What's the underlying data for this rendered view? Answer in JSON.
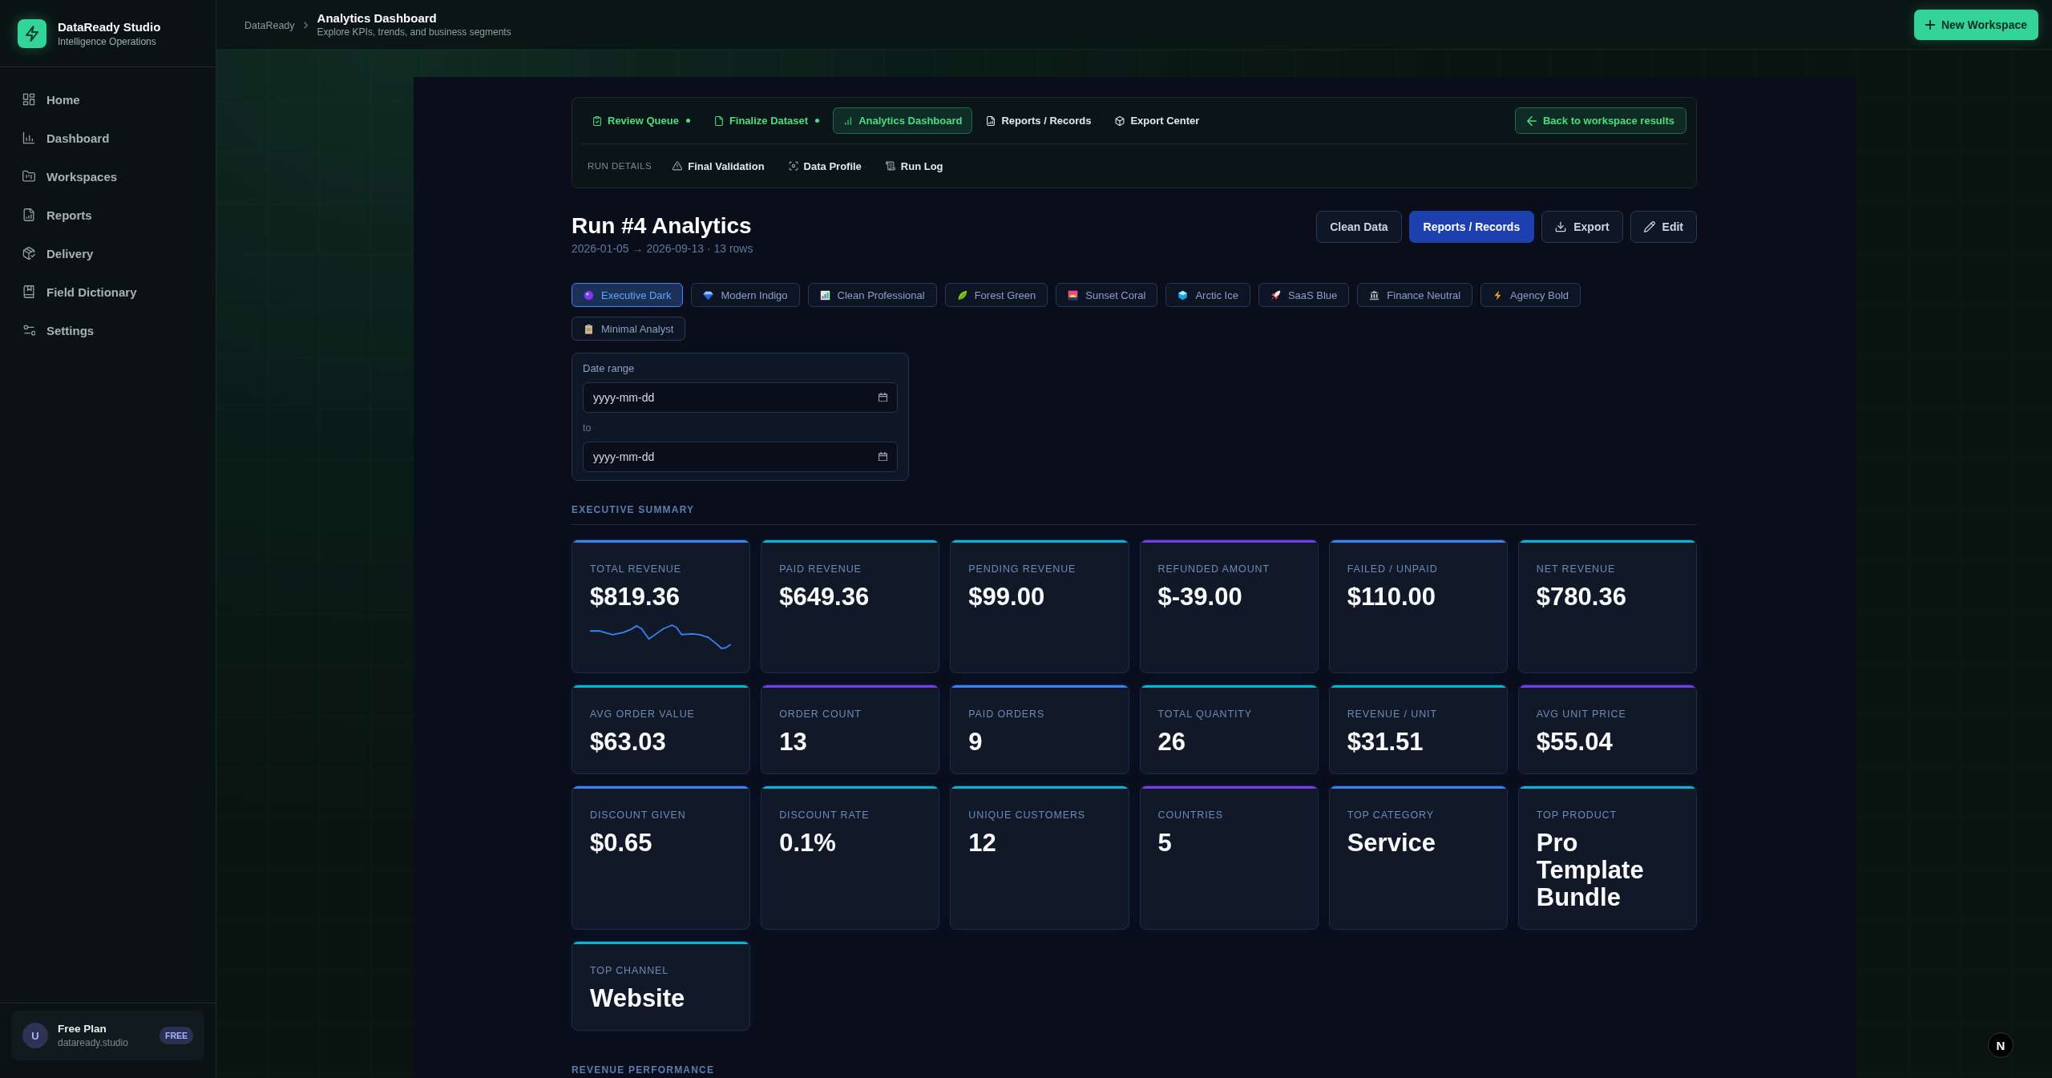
{
  "sidebar": {
    "brand": {
      "name": "DataReady Studio",
      "tagline": "Intelligence Operations"
    },
    "nav": [
      "Home",
      "Dashboard",
      "Workspaces",
      "Reports",
      "Delivery",
      "Field Dictionary",
      "Settings"
    ],
    "plan": {
      "avatar": "U",
      "title": "Free Plan",
      "domain": "dataready.studio",
      "badge": "FREE"
    }
  },
  "header": {
    "breadcrumb": "DataReady",
    "title": "Analytics Dashboard",
    "subtitle": "Explore KPIs, trends, and business segments",
    "button": "New Workspace"
  },
  "workflow": {
    "tabs": [
      {
        "label": "Review Queue",
        "selected": false,
        "done": true
      },
      {
        "label": "Finalize Dataset",
        "selected": false,
        "done": true
      },
      {
        "label": "Analytics Dashboard",
        "selected": true,
        "done": false
      },
      {
        "label": "Reports / Records",
        "selected": false,
        "done": false
      },
      {
        "label": "Export Center",
        "selected": false,
        "done": false
      }
    ],
    "back_button": "Back to workspace results",
    "run_details": {
      "label": "RUN DETAILS",
      "links": [
        "Final Validation",
        "Data Profile",
        "Run Log"
      ]
    }
  },
  "run": {
    "title": "Run #4 Analytics",
    "meta": "2026-01-05 → 2026-09-13 · 13 rows",
    "actions": [
      {
        "label": "Clean Data",
        "kind": "secondary"
      },
      {
        "label": "Reports / Records",
        "kind": "primary"
      },
      {
        "label": "Export",
        "kind": "secondary"
      },
      {
        "label": "Edit",
        "kind": "secondary"
      }
    ]
  },
  "themes": [
    {
      "label": "Executive Dark",
      "selected": true
    },
    {
      "label": "Modern Indigo",
      "selected": false
    },
    {
      "label": "Clean Professional",
      "selected": false
    },
    {
      "label": "Forest Green",
      "selected": false
    },
    {
      "label": "Sunset Coral",
      "selected": false
    },
    {
      "label": "Arctic Ice",
      "selected": false
    },
    {
      "label": "SaaS Blue",
      "selected": false
    },
    {
      "label": "Finance Neutral",
      "selected": false
    },
    {
      "label": "Agency Bold",
      "selected": false
    },
    {
      "label": "Minimal Analyst",
      "selected": false
    }
  ],
  "date_range": {
    "label": "Date range",
    "fields": [
      {
        "placeholder": "yyyy-mm-dd"
      },
      {
        "placeholder": "yyyy-mm-dd"
      }
    ],
    "separator": "to"
  },
  "executive_summary": {
    "title": "EXECUTIVE SUMMARY",
    "kpis": [
      {
        "label": "TOTAL REVENUE",
        "value": "$819.36",
        "color": "#3b82f6",
        "sparkline": true
      },
      {
        "label": "PAID REVENUE",
        "value": "$649.36",
        "color": "#06b6d4",
        "sparkline": false
      },
      {
        "label": "PENDING REVENUE",
        "value": "$99.00",
        "color": "#06b6d4",
        "sparkline": false
      },
      {
        "label": "REFUNDED AMOUNT",
        "value": "$-39.00",
        "color": "#7c3aed",
        "sparkline": false
      },
      {
        "label": "FAILED / UNPAID",
        "value": "$110.00",
        "color": "#3b82f6",
        "sparkline": false
      },
      {
        "label": "NET REVENUE",
        "value": "$780.36",
        "color": "#06b6d4",
        "sparkline": false
      },
      {
        "label": "AVG ORDER VALUE",
        "value": "$63.03",
        "color": "#06b6d4",
        "sparkline": false
      },
      {
        "label": "ORDER COUNT",
        "value": "13",
        "color": "#7c3aed",
        "sparkline": false
      },
      {
        "label": "PAID ORDERS",
        "value": "9",
        "color": "#3b82f6",
        "sparkline": false
      },
      {
        "label": "TOTAL QUANTITY",
        "value": "26",
        "color": "#06b6d4",
        "sparkline": false
      },
      {
        "label": "REVENUE / UNIT",
        "value": "$31.51",
        "color": "#06b6d4",
        "sparkline": false
      },
      {
        "label": "AVG UNIT PRICE",
        "value": "$55.04",
        "color": "#7c3aed",
        "sparkline": false
      },
      {
        "label": "DISCOUNT GIVEN",
        "value": "$0.65",
        "color": "#3b82f6",
        "sparkline": false
      },
      {
        "label": "DISCOUNT RATE",
        "value": "0.1%",
        "color": "#06b6d4",
        "sparkline": false
      },
      {
        "label": "UNIQUE CUSTOMERS",
        "value": "12",
        "color": "#06b6d4",
        "sparkline": false
      },
      {
        "label": "COUNTRIES",
        "value": "5",
        "color": "#7c3aed",
        "sparkline": false
      },
      {
        "label": "TOP CATEGORY",
        "value": "Service",
        "color": "#3b82f6",
        "sparkline": false
      },
      {
        "label": "TOP PRODUCT",
        "value": "Pro Template Bundle",
        "color": "#06b6d4",
        "sparkline": false
      },
      {
        "label": "TOP CHANNEL",
        "value": "Website",
        "color": "#06b6d4",
        "sparkline": false
      }
    ]
  },
  "revenue_performance": {
    "title": "REVENUE PERFORMANCE"
  },
  "dev_badge": "N"
}
